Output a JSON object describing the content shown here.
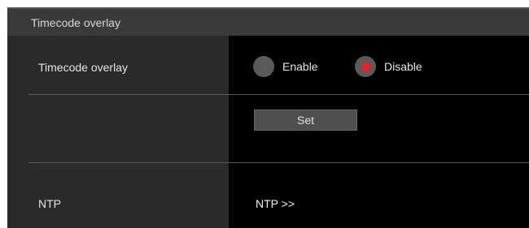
{
  "section": {
    "title": "Timecode overlay"
  },
  "timecode_overlay": {
    "label": "Timecode overlay",
    "options": [
      {
        "label": "Enable",
        "selected": false
      },
      {
        "label": "Disable",
        "selected": true
      }
    ]
  },
  "set_button": {
    "label": "Set"
  },
  "ntp": {
    "label": "NTP",
    "link_label": "NTP >>"
  },
  "colors": {
    "selected_radio": "#e0252b",
    "panel_background": "#000000",
    "label_column": "#2a2a2a",
    "header_background": "#3a3a3a"
  }
}
